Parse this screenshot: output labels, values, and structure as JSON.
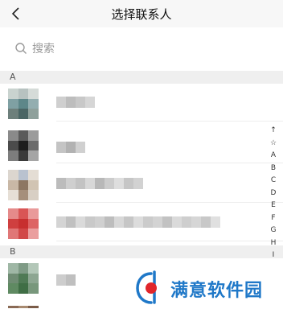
{
  "navbar": {
    "title": "选择联系人",
    "back_icon": "chevron-left-icon"
  },
  "search": {
    "placeholder": "搜索",
    "icon": "search-icon"
  },
  "sections": [
    {
      "letter": "A"
    },
    {
      "letter": "B"
    }
  ],
  "index_bar": [
    "↑",
    "☆",
    "A",
    "B",
    "C",
    "D",
    "E",
    "F",
    "G",
    "H",
    "I"
  ],
  "watermark": {
    "text": "满意软件园"
  },
  "colors": {
    "navbar_bg": "#f7f7f7",
    "section_bg": "#efefef",
    "watermark_blue": "#1f78c8",
    "watermark_red": "#e0262b"
  }
}
